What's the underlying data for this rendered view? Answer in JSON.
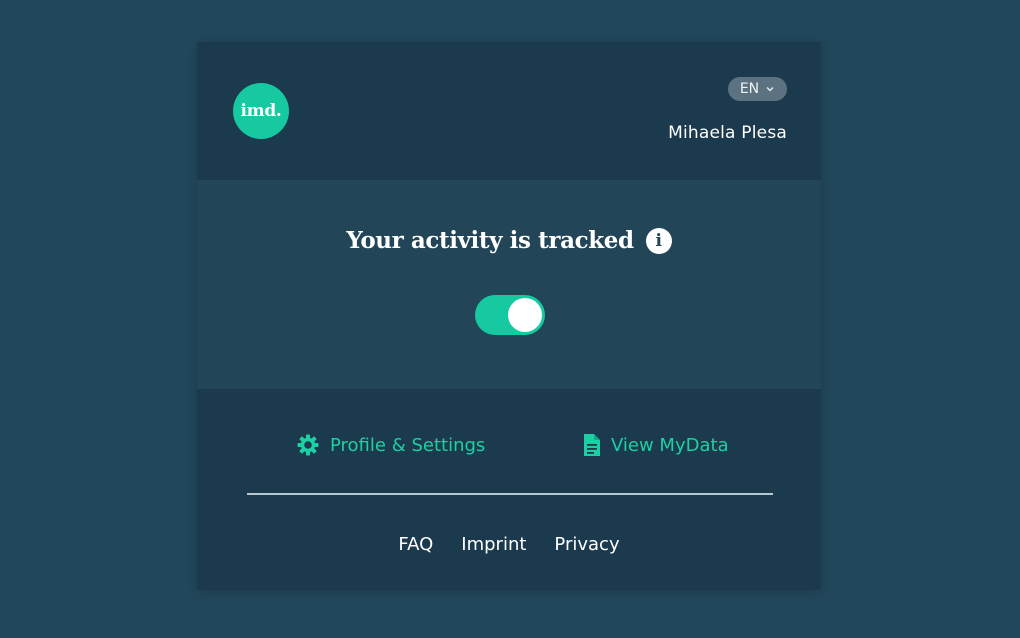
{
  "header": {
    "logo_text": "imd.",
    "language": "EN",
    "username": "Mihaela Plesa"
  },
  "tracking": {
    "title": "Your activity is tracked",
    "info_symbol": "i",
    "toggle_on": true
  },
  "links": {
    "profile_label": "Profile & Settings",
    "profile_icon": "gear-icon",
    "mydata_label": "View MyData",
    "mydata_icon": "document-icon"
  },
  "footer": {
    "faq": "FAQ",
    "imprint": "Imprint",
    "privacy": "Privacy"
  },
  "colors": {
    "background": "#22475b",
    "panel": "#1b3a4d",
    "tracking_panel": "#224558",
    "accent": "#16c9a0",
    "lang_pill": "#5c7280",
    "divider": "#b9c7cf"
  }
}
